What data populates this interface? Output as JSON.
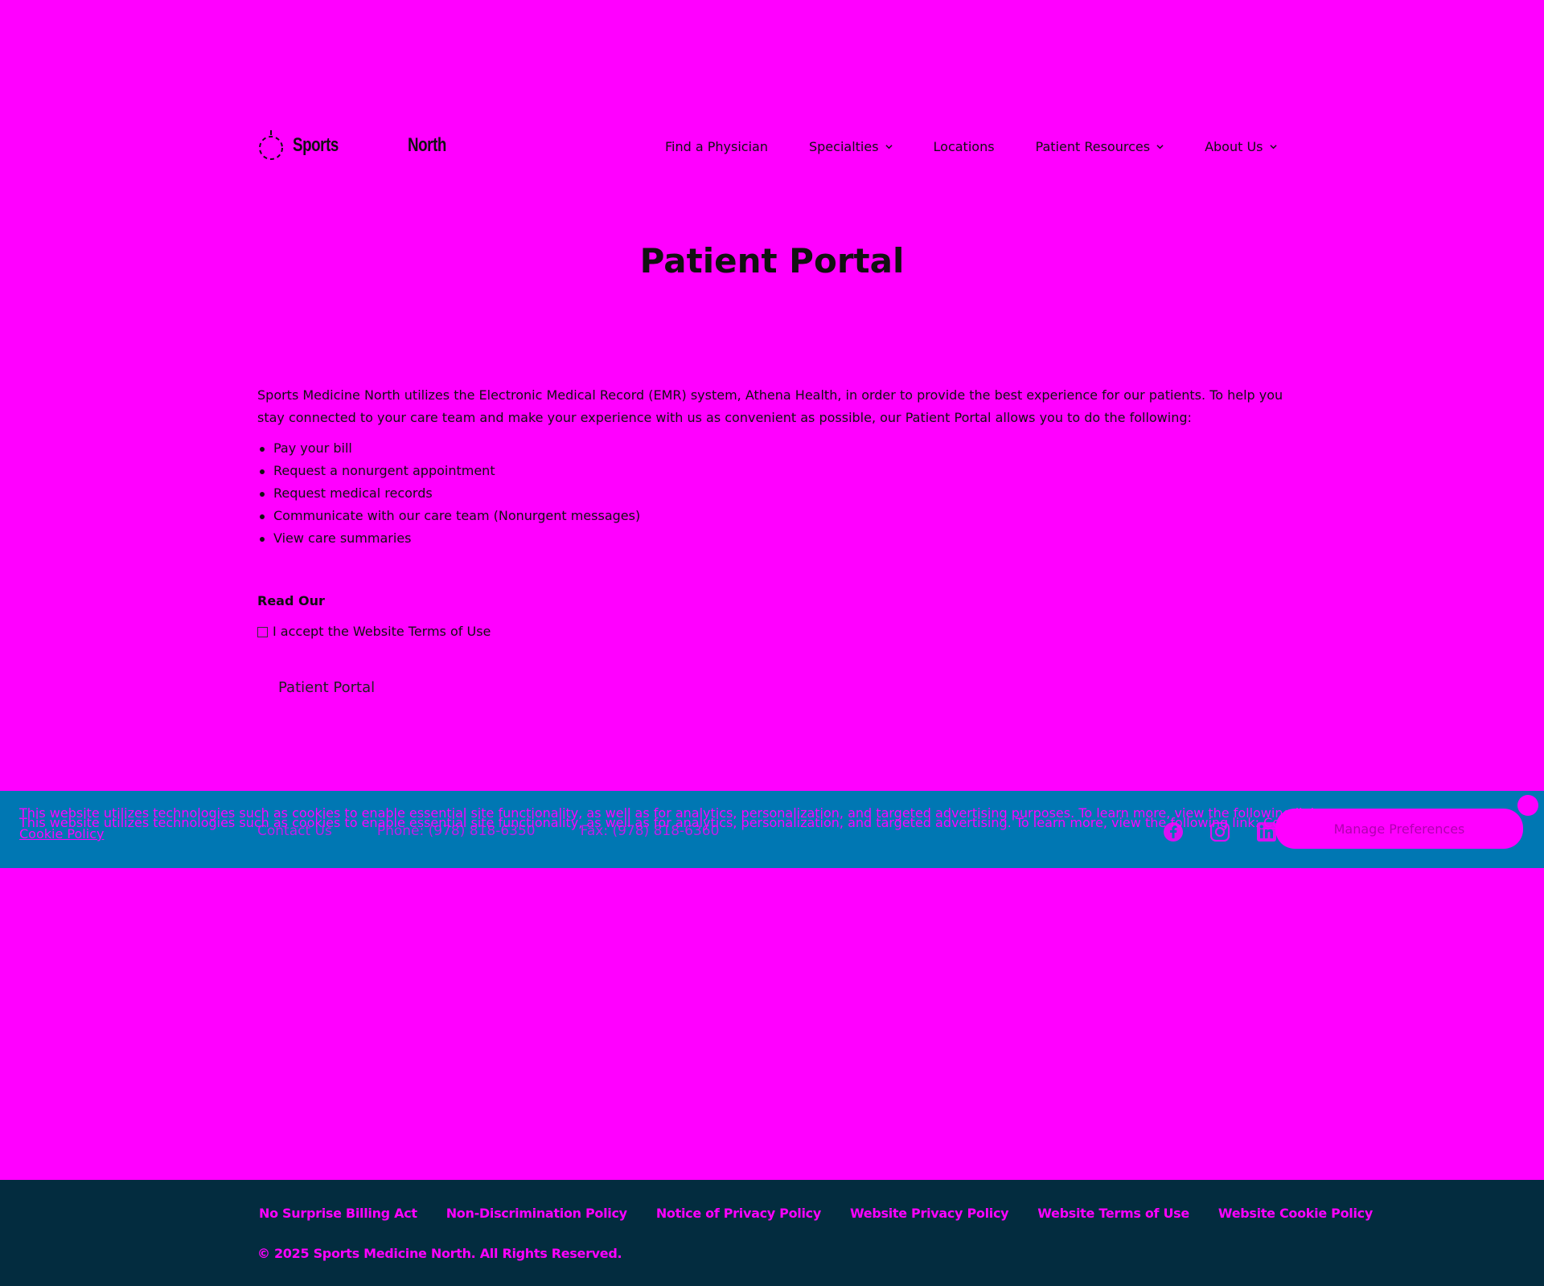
{
  "logo": {
    "word1": "Sports",
    "word2": "North"
  },
  "nav": {
    "items": [
      {
        "label": "Find a Physician",
        "has_dropdown": false
      },
      {
        "label": "Specialties",
        "has_dropdown": true
      },
      {
        "label": "Locations",
        "has_dropdown": false
      },
      {
        "label": "Patient Resources",
        "has_dropdown": true
      },
      {
        "label": "About Us",
        "has_dropdown": true
      }
    ]
  },
  "hero": {
    "title": "Patient Portal"
  },
  "content": {
    "intro": "Sports Medicine North utilizes the Electronic Medical Record (EMR) system, Athena Health, in order to provide the best experience for our patients. To help you stay connected to your care team and make your experience with us as convenient as possible, our Patient Portal allows you to do the following:",
    "bullets": [
      "Pay your bill",
      "Request a nonurgent appointment",
      "Request medical records",
      "Communicate with our care team (Nonurgent messages)",
      "View care summaries"
    ],
    "read_our": "Read Our",
    "accept_label": "I accept the Website Terms of Use",
    "portal_button": "Patient Portal"
  },
  "contact": {
    "contact_us": "Contact Us",
    "phone": "Phone: (978) 818-6350",
    "fax": "Fax: (978) 818-6360"
  },
  "cookie": {
    "line1": "This website utilizes technologies such as cookies to enable essential site functionality, as well as for analytics, personalization, and targeted advertising purposes. To learn more, view the following link:",
    "line2": "This website utilizes technologies such as cookies to enable essential site functionality, as well as for analytics, personalization, and targeted advertising. To learn more, view the following link:",
    "inline_link": "Cookie Policy",
    "link": "Cookie Policy",
    "prefs_button": "Manage Preferences"
  },
  "footer": {
    "links": [
      "No Surprise Billing Act",
      "Non-Discrimination Policy",
      "Notice of Privacy Policy",
      "Website Privacy Policy",
      "Website Terms of Use",
      "Website Cookie Policy"
    ],
    "copyright": "© 2025 Sports Medicine North. All Rights Reserved."
  },
  "colors": {
    "background": "#ff00ff",
    "contact_bar": "#0077b3",
    "footer": "#032c3f"
  }
}
